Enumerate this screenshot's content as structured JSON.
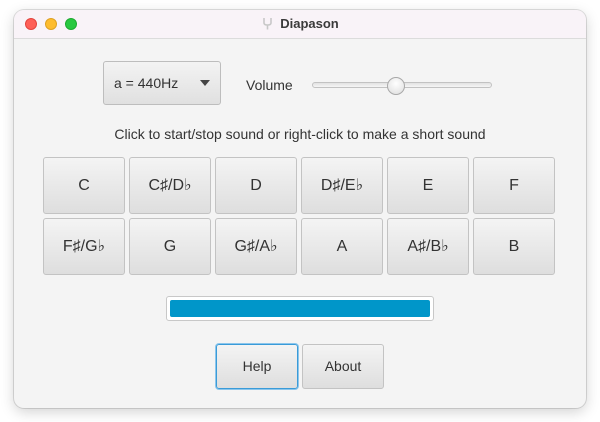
{
  "window": {
    "title": "Diapason",
    "title_icon": "tuning-fork-icon"
  },
  "pitch_select": {
    "value": "a = 440Hz"
  },
  "volume": {
    "label": "Volume",
    "level": 0.46
  },
  "instructions": "Click to start/stop sound or right-click to make a short sound",
  "notes": [
    "C",
    "C♯/D♭",
    "D",
    "D♯/E♭",
    "E",
    "F",
    "F♯/G♭",
    "G",
    "G♯/A♭",
    "A",
    "A♯/B♭",
    "B"
  ],
  "progress": {
    "value": 1.0,
    "color": "#0096c9"
  },
  "buttons": {
    "help": "Help",
    "about": "About"
  }
}
